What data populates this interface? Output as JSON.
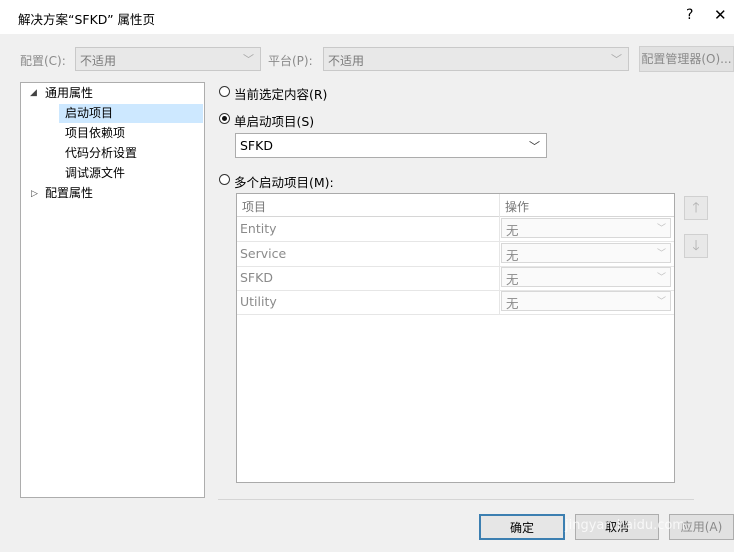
{
  "window": {
    "title": "解决方案“SFKD” 属性页",
    "help": "?",
    "close": "✕"
  },
  "toolbar": {
    "config_label": "配置(C):",
    "config_value": "不适用",
    "platform_label": "平台(P):",
    "platform_value": "不适用",
    "config_manager": "配置管理器(O)..."
  },
  "tree": [
    {
      "label": "通用属性",
      "expanded": true
    },
    {
      "label": "启动项目",
      "selected": true
    },
    {
      "label": "项目依赖项"
    },
    {
      "label": "代码分析设置"
    },
    {
      "label": "调试源文件"
    },
    {
      "label": "配置属性",
      "expanded": false
    }
  ],
  "options": {
    "current": "当前选定内容(R)",
    "single": "单启动项目(S)",
    "single_value": "SFKD",
    "multiple": "多个启动项目(M):"
  },
  "grid": {
    "headers": [
      "项目",
      "操作"
    ],
    "rows": [
      {
        "project": "Entity",
        "action": "无"
      },
      {
        "project": "Service",
        "action": "无"
      },
      {
        "project": "SFKD",
        "action": "无"
      },
      {
        "project": "Utility",
        "action": "无"
      }
    ]
  },
  "buttons": {
    "ok": "确定",
    "cancel": "取消",
    "apply": "应用(A)"
  },
  "watermark": "jingyan.baidu.com"
}
